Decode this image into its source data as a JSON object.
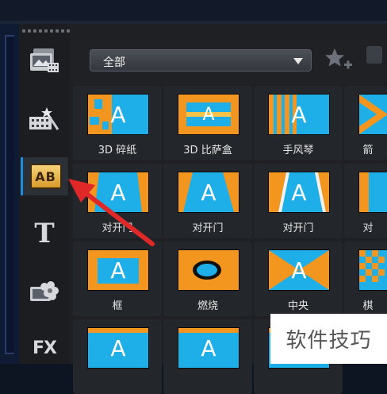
{
  "filter_dropdown": {
    "value": "全部"
  },
  "sidebar": {
    "items": [
      {
        "icon": "media-library-icon"
      },
      {
        "icon": "instant-project-icon"
      },
      {
        "icon": "transition-ab-icon",
        "label": "AB"
      },
      {
        "icon": "title-text-icon",
        "label": "T"
      },
      {
        "icon": "graphics-icon"
      },
      {
        "icon": "filter-fx-icon",
        "label": "FX"
      }
    ]
  },
  "toolbar": {
    "favorite_icon": "star-add-icon"
  },
  "transitions": [
    {
      "label": "3D 碎纸"
    },
    {
      "label": "3D 比萨盒"
    },
    {
      "label": "手风琴"
    },
    {
      "label": "箭"
    },
    {
      "label": "对开门"
    },
    {
      "label": "对开门"
    },
    {
      "label": "对开门"
    },
    {
      "label": "对"
    },
    {
      "label": "框"
    },
    {
      "label": "燃烧"
    },
    {
      "label": "中央"
    },
    {
      "label": "棋"
    },
    {
      "label": ""
    },
    {
      "label": ""
    },
    {
      "label": ""
    }
  ],
  "thumb_letter": "A",
  "watermark": {
    "text": "软件技巧"
  },
  "colors": {
    "orange": "#f29620",
    "blue": "#1eaee8",
    "accent": "#1a8de0",
    "arrow": "#e02828"
  }
}
